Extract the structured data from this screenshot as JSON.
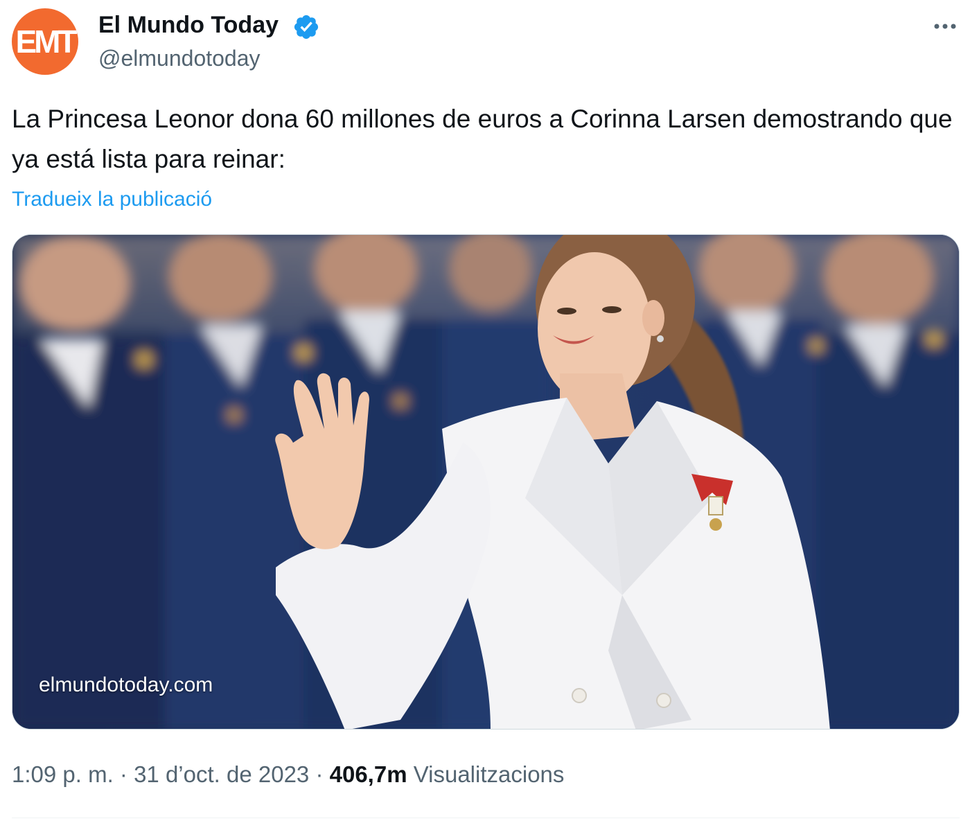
{
  "author": {
    "avatar_text": "EMT",
    "name": "El Mundo Today",
    "handle": "@elmundotoday",
    "verified_icon": "verified-badge-icon"
  },
  "more_icon": "more-options-icon",
  "tweet": {
    "text": "La Princesa Leonor dona 60 millones de euros a Corinna Larsen demostrando que ya está lista para reinar:",
    "translate_label": "Tradueix la publicació"
  },
  "media": {
    "watermark": "elmundotoday.com"
  },
  "meta": {
    "time": "1:09 p. m.",
    "separator_1": " · ",
    "date": "31 d’oct. de 2023",
    "separator_2": " · ",
    "views_count": "406,7m",
    "views_label": "Visualitzacions"
  },
  "colors": {
    "avatar": "#f26a2f",
    "verified": "#1d9bf0",
    "link": "#1d9bf0",
    "secondary_text": "#536471",
    "primary_text": "#0f1419"
  }
}
